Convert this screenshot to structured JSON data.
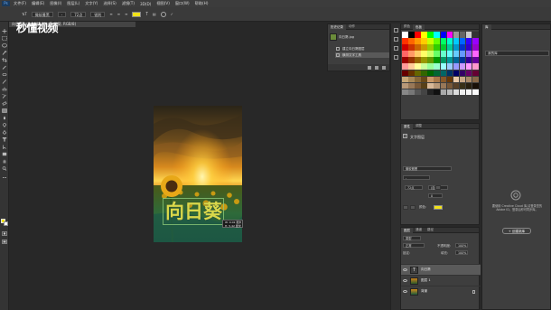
{
  "app": {
    "logo_text": "Ps",
    "menu": [
      "文件(F)",
      "编辑(E)",
      "图像(I)",
      "图层(L)",
      "文字(Y)",
      "选择(S)",
      "滤镜(T)",
      "3D(D)",
      "视图(V)",
      "窗口(W)",
      "帮助(H)"
    ]
  },
  "options_bar": {
    "font_family": "微软雅黑",
    "font_style": "-",
    "font_size": "72点",
    "antialias": "锐利",
    "text_color": "#f2e318"
  },
  "document": {
    "tab_title": "向日葵.psd @ 33.3% (向日葵, RGB/8)"
  },
  "watermark": {
    "text": "秒懂视频"
  },
  "artwork": {
    "overlay_text": "向日葵",
    "tooltip_line1": "W: 9.02 厘米",
    "tooltip_line2": "H: 5.42 厘米"
  },
  "history": {
    "tabs": [
      "历史记录",
      "动作"
    ],
    "snapshot_label": "向日葵.jpg",
    "items": [
      "建立向日葵图层",
      "横排文字工具"
    ],
    "active_item": 1
  },
  "swatches": {
    "tabs": [
      "颜色",
      "色板"
    ],
    "colors": [
      "#ffffff",
      "#000000",
      "#ff0000",
      "#ffff00",
      "#00ff00",
      "#00ffff",
      "#0000ff",
      "#ff00ff",
      "#999999",
      "#666666",
      "#cccccc",
      "#333333",
      "#ff3300",
      "#ff6600",
      "#ff9900",
      "#ffcc00",
      "#ccff00",
      "#66ff00",
      "#00ff66",
      "#00ffcc",
      "#00ccff",
      "#0066ff",
      "#3300ff",
      "#9900ff",
      "#cc0000",
      "#cc3300",
      "#cc6600",
      "#cc9900",
      "#99cc00",
      "#33cc00",
      "#00cc33",
      "#00cc99",
      "#0099cc",
      "#0033cc",
      "#3300cc",
      "#9900cc",
      "#ff6666",
      "#ff9966",
      "#ffcc66",
      "#ffff66",
      "#ccff66",
      "#66ff66",
      "#66ffcc",
      "#66ffff",
      "#66ccff",
      "#6699ff",
      "#9966ff",
      "#ff66ff",
      "#990000",
      "#993300",
      "#996600",
      "#999900",
      "#669900",
      "#009900",
      "#009966",
      "#009999",
      "#006699",
      "#003399",
      "#330099",
      "#660099",
      "#ff9999",
      "#ffcc99",
      "#ffff99",
      "#ccff99",
      "#99ff99",
      "#99ffcc",
      "#99ffff",
      "#99ccff",
      "#9999ff",
      "#cc99ff",
      "#ff99ff",
      "#ff99cc",
      "#660000",
      "#663300",
      "#666600",
      "#336600",
      "#006600",
      "#006633",
      "#006666",
      "#003366",
      "#000066",
      "#330066",
      "#660066",
      "#660033",
      "#c8a878",
      "#a88858",
      "#886838",
      "#684818",
      "#c89868",
      "#a87848",
      "#885828",
      "#683808",
      "#e8c8a8",
      "#c8a888",
      "#a88868",
      "#886848",
      "#b89878",
      "#987858",
      "#785838",
      "#584018",
      "#d8b898",
      "#b89878",
      "#987858",
      "#785838",
      "#584028",
      "#383018",
      "#282010",
      "#181008",
      "#888888",
      "#777777",
      "#555555",
      "#444444",
      "#222222",
      "#111111",
      "#aaaaaa",
      "#bbbbbb",
      "#dddddd",
      "#eeeeee",
      "#f5f5f5",
      "#fafafa"
    ]
  },
  "properties": {
    "tabs": [
      "属性",
      "调整"
    ],
    "title": "文字图层",
    "font_family": "微软雅黑",
    "font_style": "-",
    "font_size": "72点",
    "leading": "(自动)",
    "tracking": "0",
    "color_label": "颜色:",
    "text_color": "#f2e318"
  },
  "layers": {
    "tabs": [
      "图层",
      "通道",
      "路径"
    ],
    "kind_label": "类型",
    "blend_mode": "正常",
    "opacity_label": "不透明度:",
    "opacity": "100%",
    "lock_label": "锁定:",
    "fill_label": "填充:",
    "fill": "100%",
    "items": [
      {
        "name": "向日葵",
        "type": "text",
        "active": true
      },
      {
        "name": "图层 1",
        "type": "image",
        "active": false
      },
      {
        "name": "背景",
        "type": "image",
        "active": false
      }
    ]
  },
  "libraries": {
    "tabs": [
      "库"
    ],
    "dropdown": "我的库",
    "message": "要使用 Creative Cloud 库,请登录您的 Adobe ID。登录后即可同步库。",
    "sign_in_button": "+ 创建新库"
  }
}
